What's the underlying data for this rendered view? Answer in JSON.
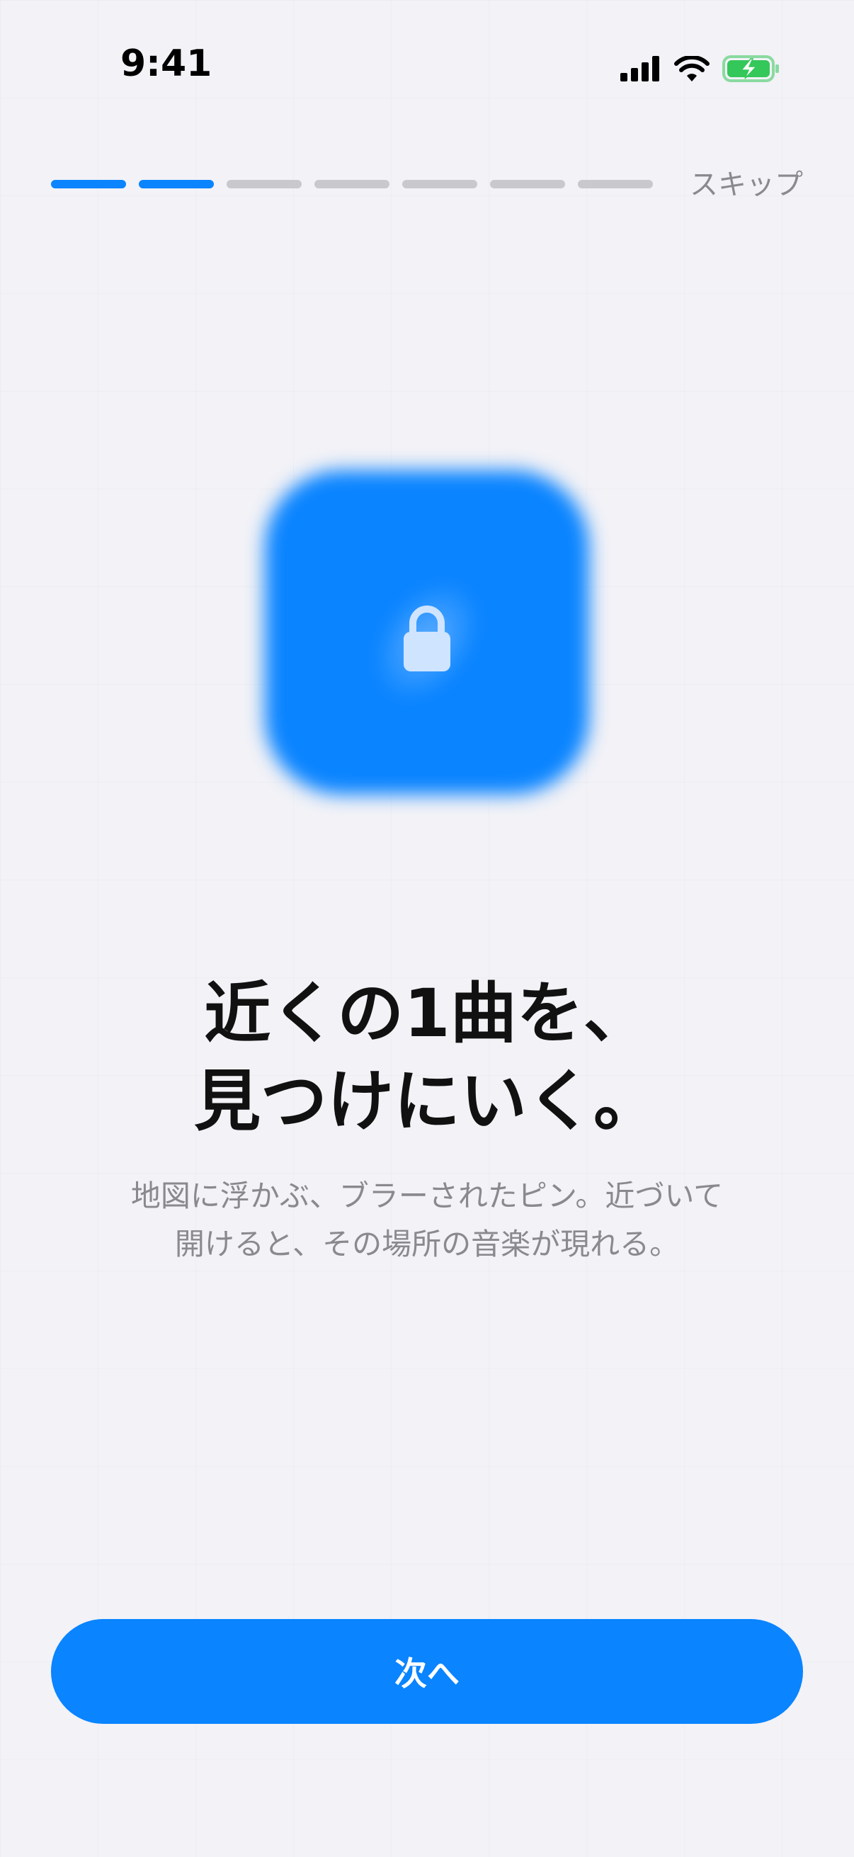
{
  "status_bar": {
    "time": "9:41",
    "signal_icon": "cellular-signal-icon",
    "wifi_icon": "wifi-icon",
    "battery_icon": "battery-charging-icon"
  },
  "onboarding": {
    "steps_total": 7,
    "steps_completed": 2,
    "skip_label": "スキップ"
  },
  "hero": {
    "icon": "lock-icon",
    "color": "#0A84FF"
  },
  "title": {
    "line1": "近くの1曲を、",
    "line2": "見つけにいく。"
  },
  "description": {
    "line1": "地図に浮かぶ、ブラーされたピン。近づいて",
    "line2": "開けると、その場所の音楽が現れる。"
  },
  "next_button_label": "次へ",
  "colors": {
    "accent": "#0A84FF",
    "background": "#F2F2F7",
    "secondary_text": "#8A8A8E",
    "inactive_progress": "#C8C8CD",
    "battery_green": "#34C759"
  }
}
